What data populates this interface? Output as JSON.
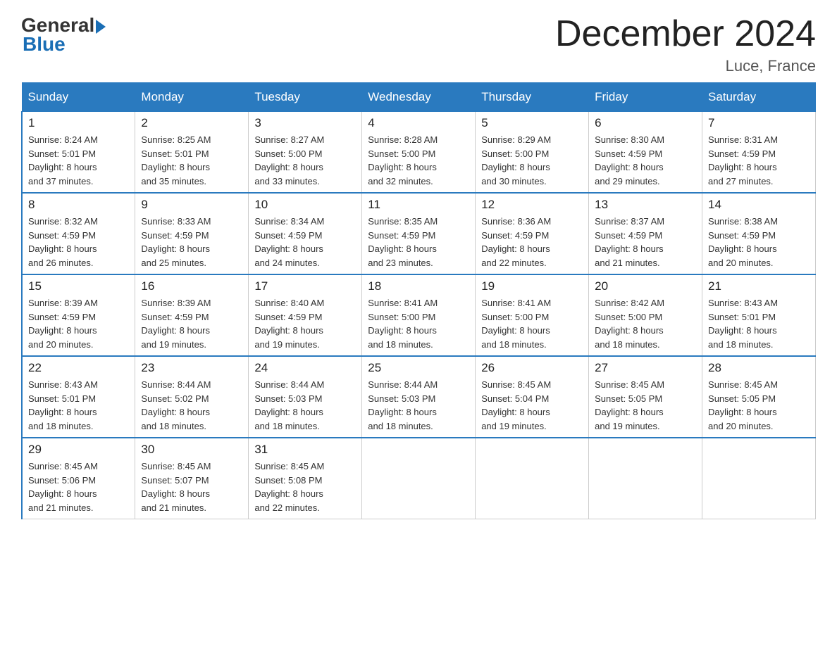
{
  "header": {
    "logo_general": "General",
    "logo_blue": "Blue",
    "month_title": "December 2024",
    "location": "Luce, France"
  },
  "days_of_week": [
    "Sunday",
    "Monday",
    "Tuesday",
    "Wednesday",
    "Thursday",
    "Friday",
    "Saturday"
  ],
  "weeks": [
    [
      {
        "day": "1",
        "sunrise": "8:24 AM",
        "sunset": "5:01 PM",
        "daylight": "8 hours and 37 minutes."
      },
      {
        "day": "2",
        "sunrise": "8:25 AM",
        "sunset": "5:01 PM",
        "daylight": "8 hours and 35 minutes."
      },
      {
        "day": "3",
        "sunrise": "8:27 AM",
        "sunset": "5:00 PM",
        "daylight": "8 hours and 33 minutes."
      },
      {
        "day": "4",
        "sunrise": "8:28 AM",
        "sunset": "5:00 PM",
        "daylight": "8 hours and 32 minutes."
      },
      {
        "day": "5",
        "sunrise": "8:29 AM",
        "sunset": "5:00 PM",
        "daylight": "8 hours and 30 minutes."
      },
      {
        "day": "6",
        "sunrise": "8:30 AM",
        "sunset": "4:59 PM",
        "daylight": "8 hours and 29 minutes."
      },
      {
        "day": "7",
        "sunrise": "8:31 AM",
        "sunset": "4:59 PM",
        "daylight": "8 hours and 27 minutes."
      }
    ],
    [
      {
        "day": "8",
        "sunrise": "8:32 AM",
        "sunset": "4:59 PM",
        "daylight": "8 hours and 26 minutes."
      },
      {
        "day": "9",
        "sunrise": "8:33 AM",
        "sunset": "4:59 PM",
        "daylight": "8 hours and 25 minutes."
      },
      {
        "day": "10",
        "sunrise": "8:34 AM",
        "sunset": "4:59 PM",
        "daylight": "8 hours and 24 minutes."
      },
      {
        "day": "11",
        "sunrise": "8:35 AM",
        "sunset": "4:59 PM",
        "daylight": "8 hours and 23 minutes."
      },
      {
        "day": "12",
        "sunrise": "8:36 AM",
        "sunset": "4:59 PM",
        "daylight": "8 hours and 22 minutes."
      },
      {
        "day": "13",
        "sunrise": "8:37 AM",
        "sunset": "4:59 PM",
        "daylight": "8 hours and 21 minutes."
      },
      {
        "day": "14",
        "sunrise": "8:38 AM",
        "sunset": "4:59 PM",
        "daylight": "8 hours and 20 minutes."
      }
    ],
    [
      {
        "day": "15",
        "sunrise": "8:39 AM",
        "sunset": "4:59 PM",
        "daylight": "8 hours and 20 minutes."
      },
      {
        "day": "16",
        "sunrise": "8:39 AM",
        "sunset": "4:59 PM",
        "daylight": "8 hours and 19 minutes."
      },
      {
        "day": "17",
        "sunrise": "8:40 AM",
        "sunset": "4:59 PM",
        "daylight": "8 hours and 19 minutes."
      },
      {
        "day": "18",
        "sunrise": "8:41 AM",
        "sunset": "5:00 PM",
        "daylight": "8 hours and 18 minutes."
      },
      {
        "day": "19",
        "sunrise": "8:41 AM",
        "sunset": "5:00 PM",
        "daylight": "8 hours and 18 minutes."
      },
      {
        "day": "20",
        "sunrise": "8:42 AM",
        "sunset": "5:00 PM",
        "daylight": "8 hours and 18 minutes."
      },
      {
        "day": "21",
        "sunrise": "8:43 AM",
        "sunset": "5:01 PM",
        "daylight": "8 hours and 18 minutes."
      }
    ],
    [
      {
        "day": "22",
        "sunrise": "8:43 AM",
        "sunset": "5:01 PM",
        "daylight": "8 hours and 18 minutes."
      },
      {
        "day": "23",
        "sunrise": "8:44 AM",
        "sunset": "5:02 PM",
        "daylight": "8 hours and 18 minutes."
      },
      {
        "day": "24",
        "sunrise": "8:44 AM",
        "sunset": "5:03 PM",
        "daylight": "8 hours and 18 minutes."
      },
      {
        "day": "25",
        "sunrise": "8:44 AM",
        "sunset": "5:03 PM",
        "daylight": "8 hours and 18 minutes."
      },
      {
        "day": "26",
        "sunrise": "8:45 AM",
        "sunset": "5:04 PM",
        "daylight": "8 hours and 19 minutes."
      },
      {
        "day": "27",
        "sunrise": "8:45 AM",
        "sunset": "5:05 PM",
        "daylight": "8 hours and 19 minutes."
      },
      {
        "day": "28",
        "sunrise": "8:45 AM",
        "sunset": "5:05 PM",
        "daylight": "8 hours and 20 minutes."
      }
    ],
    [
      {
        "day": "29",
        "sunrise": "8:45 AM",
        "sunset": "5:06 PM",
        "daylight": "8 hours and 21 minutes."
      },
      {
        "day": "30",
        "sunrise": "8:45 AM",
        "sunset": "5:07 PM",
        "daylight": "8 hours and 21 minutes."
      },
      {
        "day": "31",
        "sunrise": "8:45 AM",
        "sunset": "5:08 PM",
        "daylight": "8 hours and 22 minutes."
      },
      null,
      null,
      null,
      null
    ]
  ],
  "labels": {
    "sunrise": "Sunrise:",
    "sunset": "Sunset:",
    "daylight": "Daylight:"
  }
}
